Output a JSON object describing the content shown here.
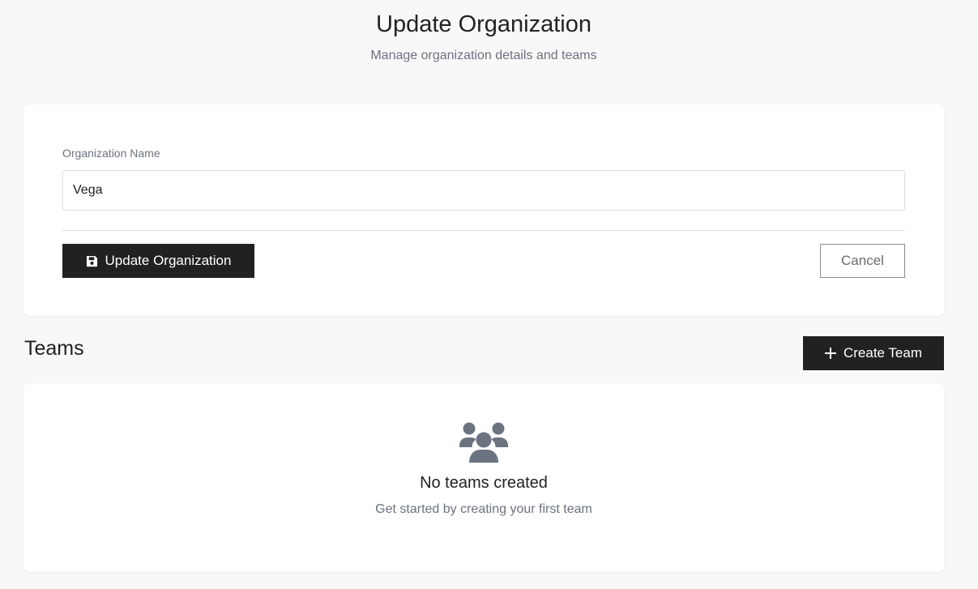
{
  "header": {
    "title": "Update Organization",
    "subtitle": "Manage organization details and teams"
  },
  "org_form": {
    "name_label": "Organization Name",
    "name_value": "Vega",
    "update_label": "Update Organization",
    "update_icon": "save-icon",
    "cancel_label": "Cancel"
  },
  "teams": {
    "title": "Teams",
    "create_label": "Create Team",
    "create_icon": "plus-icon",
    "empty_icon": "users-icon",
    "empty_title": "No teams created",
    "empty_subtitle": "Get started by creating your first team"
  },
  "colors": {
    "background": "#f8f8f8",
    "card": "#ffffff",
    "primary_button": "#212121",
    "muted_text": "#6b7280",
    "icon_gray": "#6b7280"
  }
}
